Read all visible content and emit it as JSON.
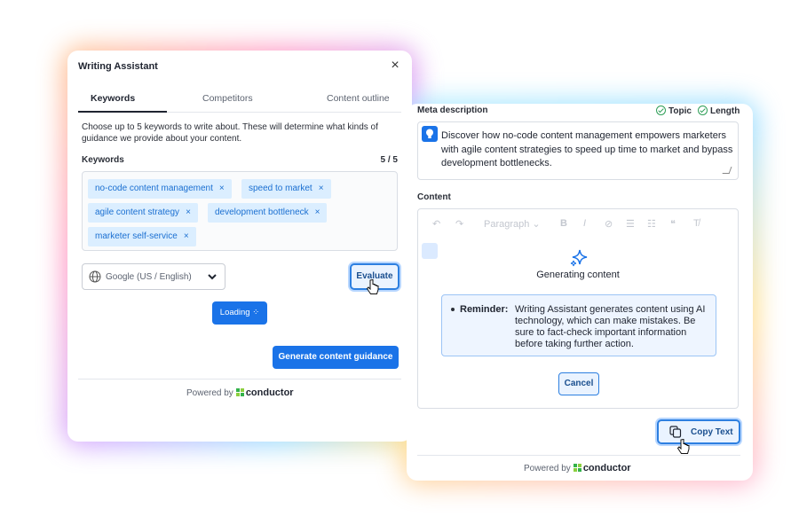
{
  "writing_assistant": {
    "title": "Writing Assistant",
    "close_glyph": "×",
    "tabs": [
      {
        "label": "Keywords",
        "active": true
      },
      {
        "label": "Competitors",
        "active": false
      },
      {
        "label": "Content outline",
        "active": false
      }
    ],
    "intro": "Choose up to 5 keywords to write about. These will determine what kinds of guidance we provide about your content.",
    "keywords_label": "Keywords",
    "keywords_count": "5 / 5",
    "keywords": [
      "no-code content management",
      "speed to market",
      "agile content strategy",
      "development bottleneck",
      "marketer self-service"
    ],
    "remove_glyph": "×",
    "search_engine": "Google (US / English)",
    "evaluate_label": "Evaluate",
    "loading_label": "Loading ⁘",
    "generate_label": "Generate content guidance",
    "powered_by": "Powered by",
    "brand": "conductor"
  },
  "editor_panel": {
    "meta_label": "Meta description",
    "badges": [
      "Topic",
      "Length"
    ],
    "meta_text": "Discover how no-code content management empowers marketers with agile content strategies to speed up time to market and bypass development bottlenecks.",
    "content_label": "Content",
    "toolbar": {
      "undo": "↶",
      "redo": "↷",
      "paragraph": "Paragraph ⌄",
      "bold": "B",
      "italic": "I",
      "link": "⊘",
      "bullets": "☰",
      "numbers": "☷",
      "quote": "❝",
      "clear": "T̸"
    },
    "generating_label": "Generating content",
    "reminder_label": "Reminder:",
    "reminder_text": "Writing Assistant generates content using AI technology, which can make mistakes. Be sure to fact-check important information before taking further action.",
    "cancel_label": "Cancel",
    "copy_label": "Copy Text",
    "powered_by": "Powered by",
    "brand": "conductor"
  },
  "colors": {
    "accent": "#1a73e8",
    "chip_bg": "#dbeeff",
    "chip_text": "#1a6fd1",
    "check_green": "#2e9e57"
  },
  "icons": [
    "close-icon",
    "remove-icon",
    "globe-icon",
    "chevron-down-icon",
    "lightbulb-icon",
    "sparkle-icon",
    "check-circle-icon",
    "copy-icon",
    "hand-cursor-icon",
    "resize-handle-icon"
  ]
}
